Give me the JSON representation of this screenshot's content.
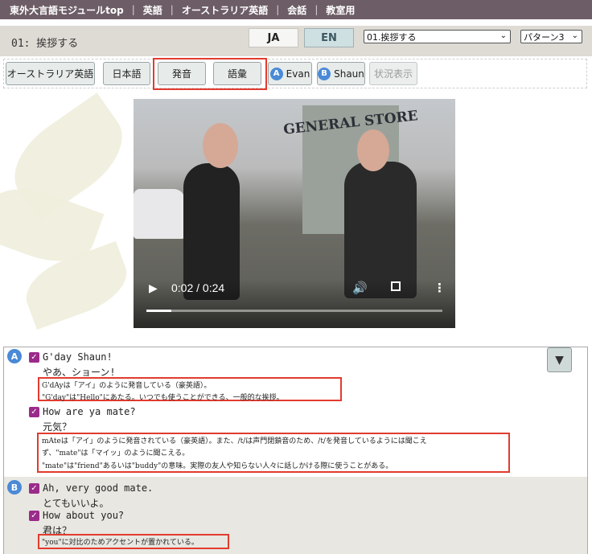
{
  "nav": {
    "items": [
      "東外大言語モジュールtop",
      "英語",
      "オーストラリア英語",
      "会話",
      "教室用"
    ]
  },
  "header": {
    "lesson_title": "01: 挨拶する",
    "lang_ja": "JA",
    "lang_en": "EN",
    "lesson_select": "01.挨拶する",
    "pattern_select": "パターン3"
  },
  "toolbar": {
    "buttons": [
      "オーストラリア英語",
      "日本語",
      "発音",
      "語彙",
      "Evan",
      "Shaun",
      "状況表示"
    ],
    "speaker_a": "A",
    "speaker_b": "B"
  },
  "video": {
    "store_sign": "GENERAL STORE",
    "time": "0:02 / 0:24",
    "progress": 0.083
  },
  "transcript": {
    "toggle": "▼",
    "a": {
      "label": "A",
      "lines": [
        {
          "en": "G'day Shaun!",
          "ja": "やあ、ショーン!",
          "notes": [
            "G'dAyは「アイ」のように発音している（豪英語）。",
            "\"G'day\"は\"Hello\"にあたる。いつでも使うことができる、一般的な挨拶。"
          ]
        },
        {
          "en": "How are ya mate?",
          "ja": "元気？",
          "notes": [
            "mAteは「アイ」のように発音されている（豪英語）。また、/t/は声門閉鎖音のため、/t/を発音しているようには聞こえ",
            "ず、\"mate\"は「マイッ」のように聞こえる。",
            "\"mate\"は\"friend\"あるいは\"buddy\"の意味。実際の友人や知らない人々に話しかける際に使うことがある。"
          ]
        }
      ]
    },
    "b": {
      "label": "B",
      "lines": [
        {
          "en": "Ah, very good mate.",
          "ja": "とてもいいよ。",
          "notes": []
        },
        {
          "en": "How about you?",
          "ja": "君は？",
          "notes": [
            "\"you\"に対比のためアクセントが置かれている。"
          ]
        }
      ]
    }
  },
  "colors": {
    "nav_bg": "#6d5d66",
    "accent_red": "#e23b2e",
    "speaker_blue": "#4a8ad6",
    "checkbox_purple": "#9b2b8a"
  }
}
